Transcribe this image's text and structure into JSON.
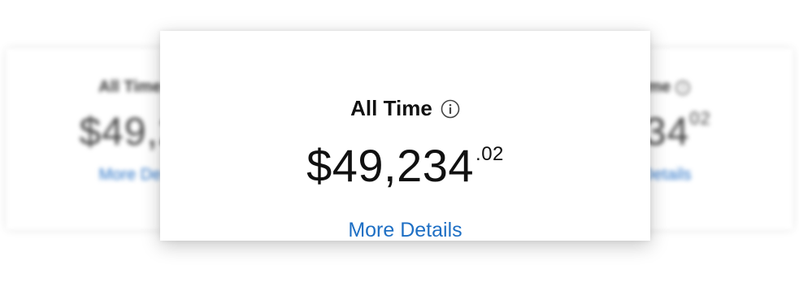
{
  "card": {
    "title": "All Time",
    "info_icon": "info-icon",
    "amount_main": "$49,234",
    "amount_cents": ".02",
    "link_label": "More Details"
  },
  "background": {
    "left": {
      "title": "All Time",
      "amount_main": "$49,2",
      "link_label": "More De"
    },
    "right": {
      "title": "ime",
      "amount_main": "234",
      "amount_cents": "02",
      "link_label": "Details"
    }
  },
  "colors": {
    "link": "#1e6fc4",
    "text": "#111111"
  }
}
